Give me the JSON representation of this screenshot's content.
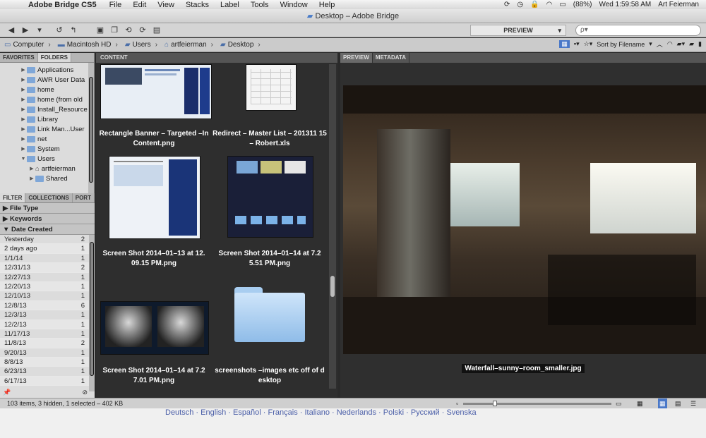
{
  "menubar": {
    "app_name": "Adobe Bridge CS5",
    "items": [
      "File",
      "Edit",
      "View",
      "Stacks",
      "Label",
      "Tools",
      "Window",
      "Help"
    ],
    "battery": "(88%)",
    "clock": "Wed 1:59:58 AM",
    "user": "Art Feierman"
  },
  "window": {
    "title": "Desktop – Adobe Bridge"
  },
  "toolbar": {
    "workspace": "PREVIEW",
    "search_placeholder": "ρ▾"
  },
  "path": {
    "crumbs": [
      "Computer",
      "Macintosh HD",
      "Users",
      "artfeierman",
      "Desktop"
    ],
    "sort_label": "Sort by Filename"
  },
  "left_panel": {
    "tabs": [
      "FAVORITES",
      "FOLDERS"
    ],
    "folders": [
      {
        "name": "Applications",
        "level": 1
      },
      {
        "name": "AWR User Data",
        "level": 1
      },
      {
        "name": "home",
        "level": 1
      },
      {
        "name": "home (from old",
        "level": 1
      },
      {
        "name": "Install_Resource",
        "level": 1
      },
      {
        "name": "Library",
        "level": 1
      },
      {
        "name": "Link Man...User",
        "level": 1
      },
      {
        "name": "net",
        "level": 1
      },
      {
        "name": "System",
        "level": 1
      },
      {
        "name": "Users",
        "level": 1
      },
      {
        "name": "artfeierman",
        "level": 2
      },
      {
        "name": "Shared",
        "level": 2
      }
    ],
    "filter_tabs": [
      "FILTER",
      "COLLECTIONS",
      "PORT"
    ],
    "filter_sections": [
      "File Type",
      "Keywords",
      "Date Created"
    ],
    "dates": [
      {
        "label": "Yesterday",
        "count": "2"
      },
      {
        "label": "2 days ago",
        "count": "1"
      },
      {
        "label": "1/1/14",
        "count": "1"
      },
      {
        "label": "12/31/13",
        "count": "2"
      },
      {
        "label": "12/27/13",
        "count": "1"
      },
      {
        "label": "12/20/13",
        "count": "1"
      },
      {
        "label": "12/10/13",
        "count": "1"
      },
      {
        "label": "12/8/13",
        "count": "6"
      },
      {
        "label": "12/3/13",
        "count": "1"
      },
      {
        "label": "12/2/13",
        "count": "1"
      },
      {
        "label": "11/17/13",
        "count": "1"
      },
      {
        "label": "11/8/13",
        "count": "2"
      },
      {
        "label": "9/20/13",
        "count": "1"
      },
      {
        "label": "8/8/13",
        "count": "1"
      },
      {
        "label": "6/23/13",
        "count": "1"
      },
      {
        "label": "6/17/13",
        "count": "1"
      }
    ]
  },
  "content": {
    "tab": "CONTENT",
    "items": [
      {
        "caption": "Rectangle Banner – Targeted –In Content.png"
      },
      {
        "caption": "Redirect – Master List – 201311 15 – Robert.xls"
      },
      {
        "caption": "Screen Shot 2014–01–13 at 12. 09.15 PM.png"
      },
      {
        "caption": "Screen Shot 2014–01–14 at 7.2 5.51 PM.png"
      },
      {
        "caption": "Screen Shot 2014–01–14 at 7.2 7.01 PM.png"
      },
      {
        "caption": "screenshots –images etc off of d esktop"
      }
    ]
  },
  "preview": {
    "tabs": [
      "PREVIEW",
      "METADATA"
    ],
    "filename": "Waterfall–sunny–room_smaller.jpg"
  },
  "status": {
    "text": "103 items, 3 hidden, 1 selected – 402 KB"
  },
  "footer": {
    "languages": "Deutsch · English · Español · Français · Italiano · Nederlands · Polski · Русский · Svenska"
  }
}
